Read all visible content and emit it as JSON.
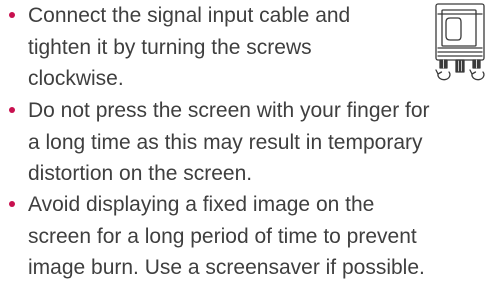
{
  "instructions": [
    {
      "lines": [
        "Connect the signal input cable and",
        "tighten it by turning the screws",
        "clockwise."
      ]
    },
    {
      "lines": [
        "Do not press the screen with your finger for",
        "a long time as this may result in temporary",
        "distortion on the screen."
      ]
    },
    {
      "lines": [
        "Avoid displaying a fixed image on the",
        "screen for a long period of time to prevent",
        "image burn. Use a screensaver if possible."
      ]
    }
  ],
  "colors": {
    "bullet": "#c8104f",
    "text": "#3f3f3f",
    "illustration_stroke": "#3a3a3a"
  },
  "icons": {
    "illustration": "signal-cable-connector-icon"
  }
}
